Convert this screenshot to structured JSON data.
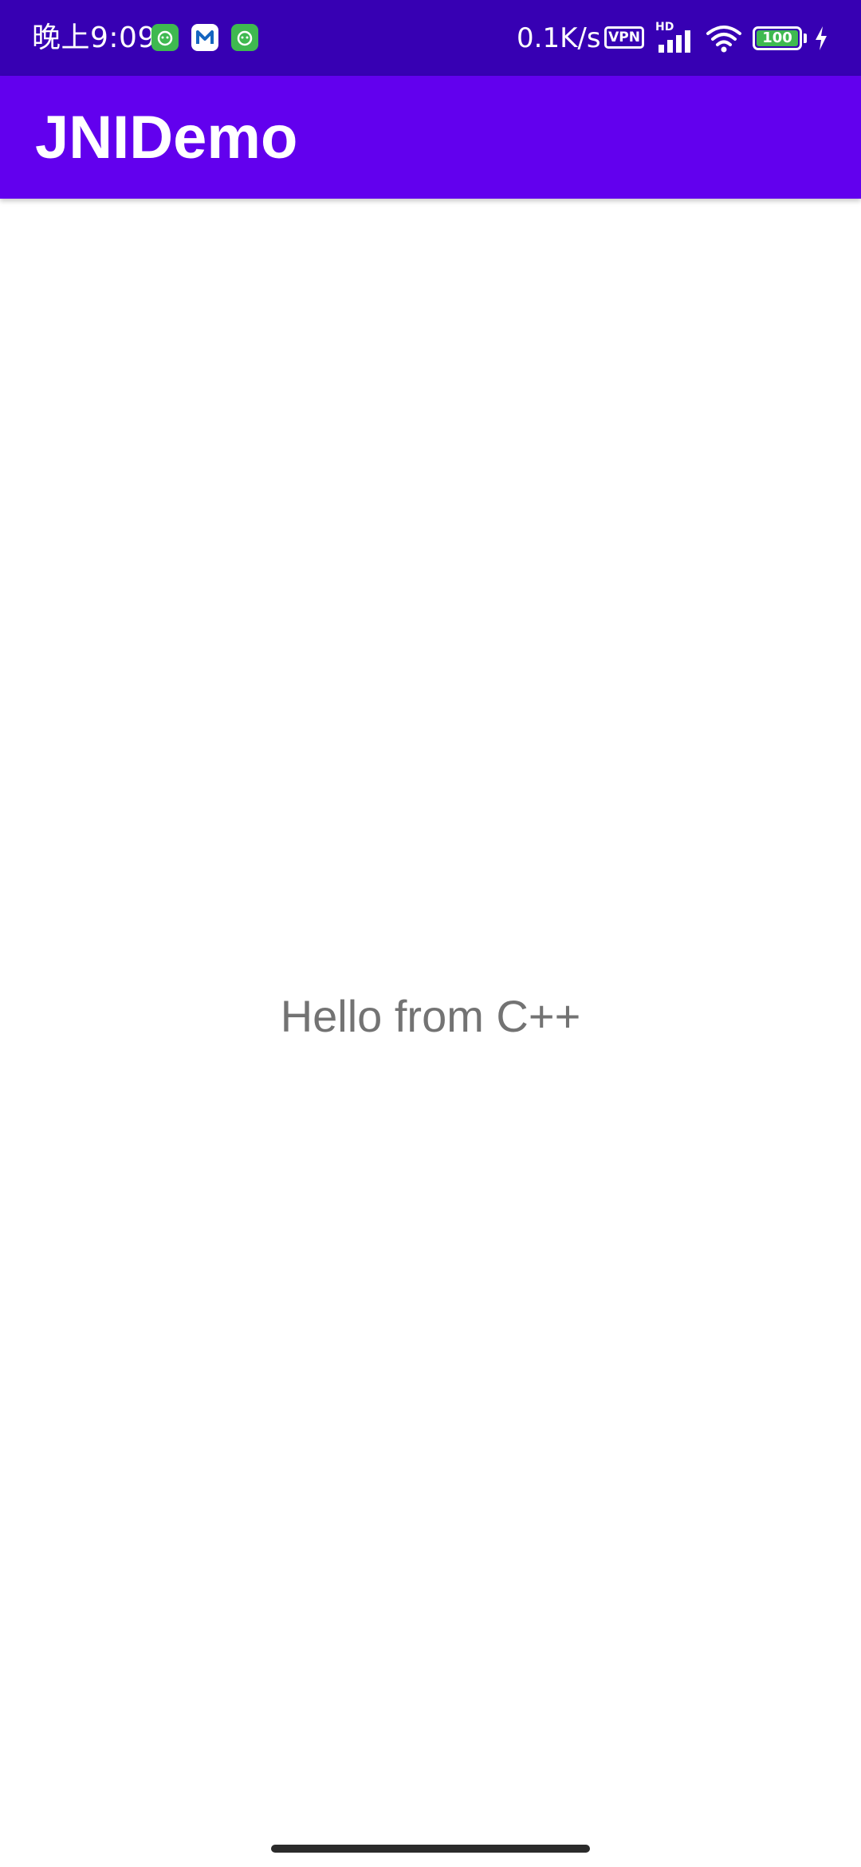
{
  "status_bar": {
    "time": "晚上9:09",
    "network_speed": "0.1K/s",
    "vpn_label": "VPN",
    "hd_label": "HD",
    "battery_level": "100",
    "notification_icons": [
      "app-green-icon",
      "mail-m-icon",
      "app-green-icon"
    ],
    "icons": [
      "signal-icon",
      "wifi-icon",
      "battery-icon",
      "charging-icon"
    ]
  },
  "app_bar": {
    "title": "JNIDemo",
    "color": "#6200ee"
  },
  "main": {
    "message": "Hello from C++"
  },
  "colors": {
    "status_bar": "#3700b3",
    "app_bar": "#6200ee",
    "message_text": "#737373",
    "battery_fill": "#3fb950"
  }
}
